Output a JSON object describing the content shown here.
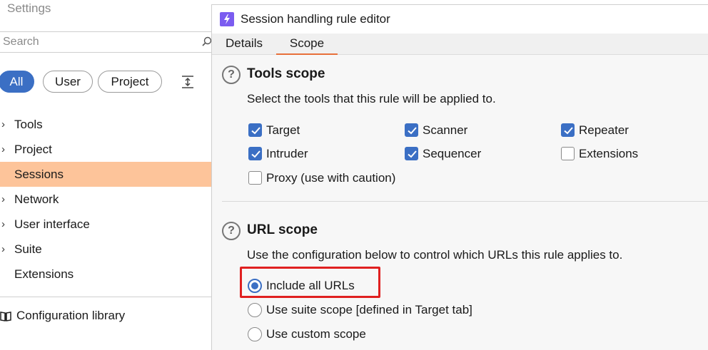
{
  "settings": {
    "title": "Settings",
    "search_placeholder": "Search",
    "filters": [
      "All",
      "User",
      "Project"
    ],
    "active_filter": "All",
    "tree": [
      {
        "label": "Tools",
        "expandable": true
      },
      {
        "label": "Project",
        "expandable": true
      },
      {
        "label": "Sessions",
        "expandable": false,
        "selected": true
      },
      {
        "label": "Network",
        "expandable": true
      },
      {
        "label": "User interface",
        "expandable": true
      },
      {
        "label": "Suite",
        "expandable": true
      },
      {
        "label": "Extensions",
        "expandable": false
      }
    ],
    "config_library": "Configuration library"
  },
  "dialog": {
    "title": "Session handling rule editor",
    "tabs": [
      "Details",
      "Scope"
    ],
    "active_tab": "Scope",
    "tools_scope": {
      "heading": "Tools scope",
      "description": "Select the tools that this rule will be applied to.",
      "tools": [
        {
          "label": "Target",
          "checked": true
        },
        {
          "label": "Scanner",
          "checked": true
        },
        {
          "label": "Repeater",
          "checked": true
        },
        {
          "label": "Intruder",
          "checked": true
        },
        {
          "label": "Sequencer",
          "checked": true
        },
        {
          "label": "Extensions",
          "checked": false
        },
        {
          "label": "Proxy (use with caution)",
          "checked": false
        }
      ]
    },
    "url_scope": {
      "heading": "URL scope",
      "description": "Use the configuration below to control which URLs this rule applies to.",
      "options": [
        {
          "label": "Include all URLs",
          "selected": true
        },
        {
          "label": "Use suite scope [defined in Target tab]",
          "selected": false
        },
        {
          "label": "Use custom scope",
          "selected": false
        }
      ]
    }
  },
  "colors": {
    "accent": "#3b6fc4",
    "selected_item": "#fdc49a",
    "tab_underline": "#e8703a",
    "highlight_box": "#e02020",
    "app_icon": "#7b5cf0"
  }
}
